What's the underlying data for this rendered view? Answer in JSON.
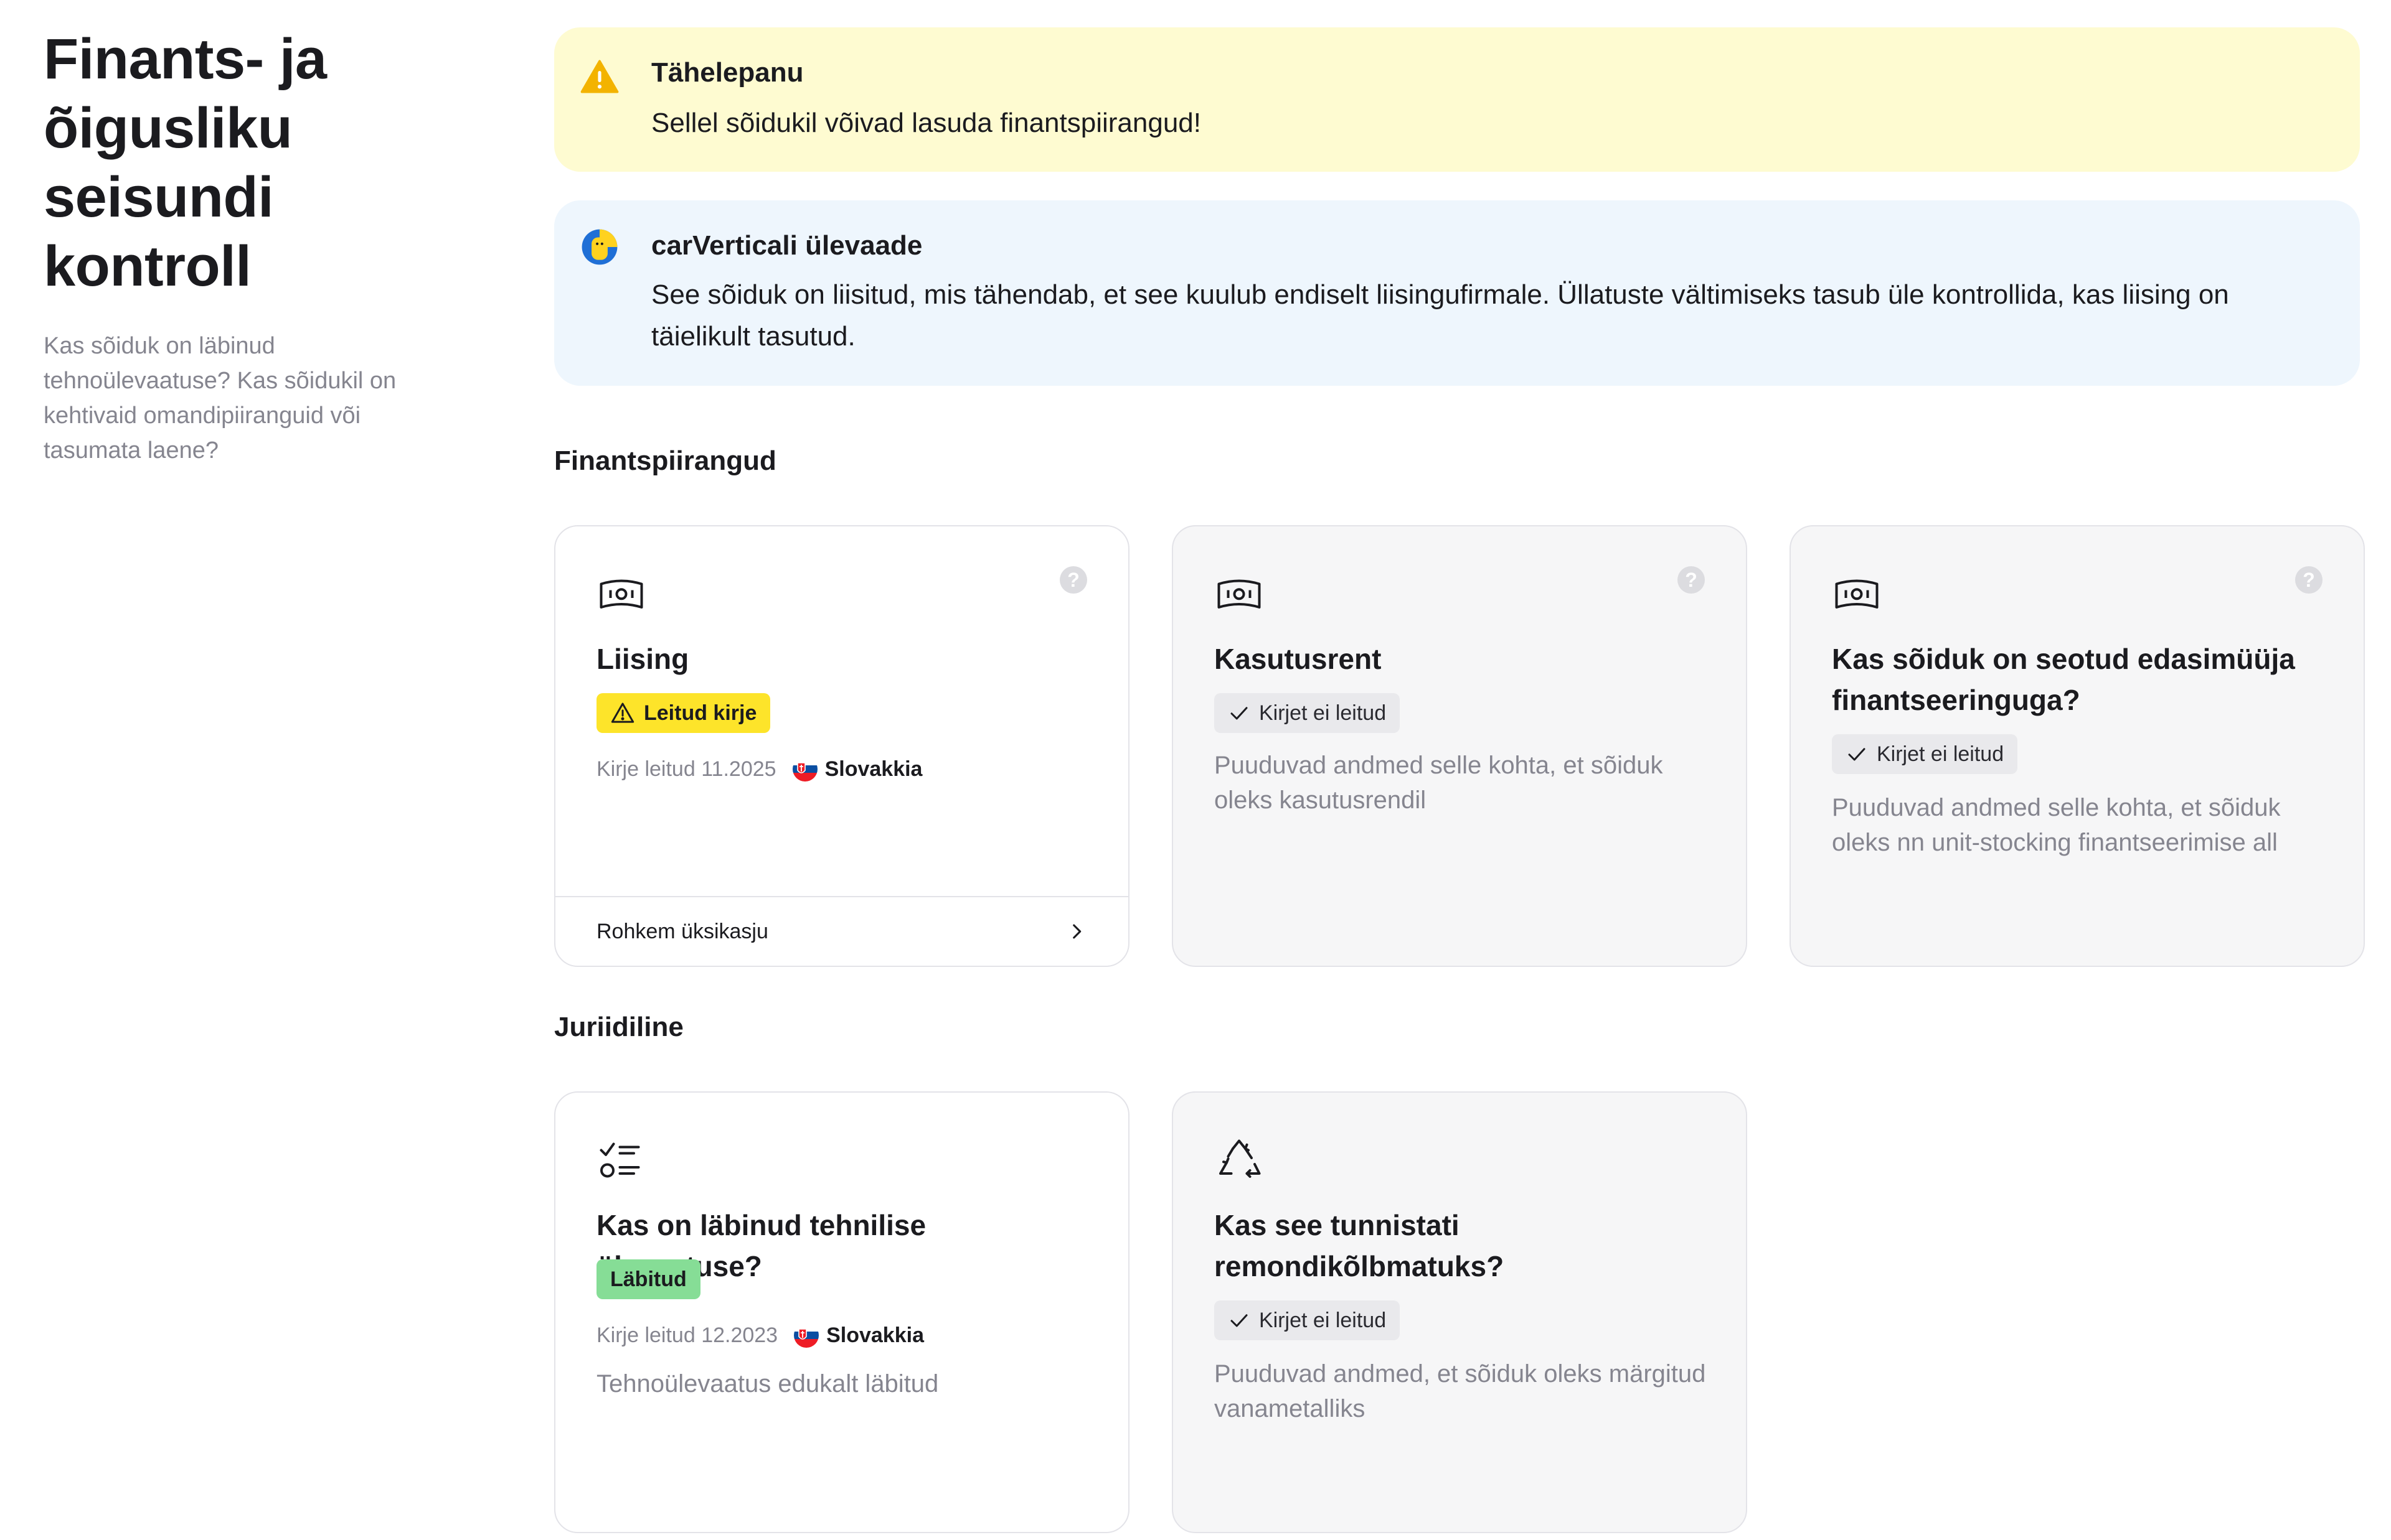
{
  "sidebar": {
    "title": "Finants- ja õigusliku seisundi kontroll",
    "subtitle": "Kas sõiduk on läbinud tehnoülevaatuse? Kas sõidukil on kehtivaid omandipiiranguid või tasumata laene?"
  },
  "alerts": {
    "warning": {
      "title": "Tähelepanu",
      "text": "Sellel sõidukil võivad lasuda finantspiirangud!",
      "icon": "warning-icon"
    },
    "info": {
      "title": "carVerticali ülevaade",
      "text": "See sõiduk on liisitud, mis tähendab, et see kuulub endiselt liisingufirmale. Üllatuste vältimiseks tasub üle kontrollida, kas liising on täielikult tasutud.",
      "icon": "carvertical-logo-icon"
    }
  },
  "sections": {
    "finance": {
      "title": "Finantspiirangud",
      "cards": [
        {
          "title": "Liising",
          "icon": "banknote-icon",
          "badge": "Leitud kirje",
          "badge_color": "#fde42a",
          "meta_date": "Kirje leitud 11.2025",
          "country": "Slovakkia",
          "footer": "Rohkem üksikasju"
        },
        {
          "title": "Kasutusrent",
          "icon": "banknote-icon",
          "badge": "Kirjet ei leitud",
          "description": "Puuduvad andmed selle kohta, et sõiduk oleks kasutusrendil"
        },
        {
          "title": "Kas sõiduk on seotud edasimüüja finantseeringuga?",
          "icon": "banknote-icon",
          "badge": "Kirjet ei leitud",
          "description": "Puuduvad andmed selle kohta, et sõiduk oleks nn unit-stocking finantseerimise all"
        }
      ]
    },
    "legal": {
      "title": "Juriidiline",
      "cards": [
        {
          "title": "Kas on läbinud tehnilise ülevaatuse?",
          "icon": "checklist-icon",
          "badge": "Läbitud",
          "badge_color": "#86dd96",
          "meta_date": "Kirje leitud 12.2023",
          "country": "Slovakkia",
          "description": "Tehnoülevaatus edukalt läbitud"
        },
        {
          "title": "Kas see tunnistati remondikõlbmatuks?",
          "icon": "recycle-icon",
          "badge": "Kirjet ei leitud",
          "description": "Puuduvad andmed, et sõiduk oleks märgitud vanametalliks"
        }
      ]
    }
  },
  "help_glyph": "?"
}
